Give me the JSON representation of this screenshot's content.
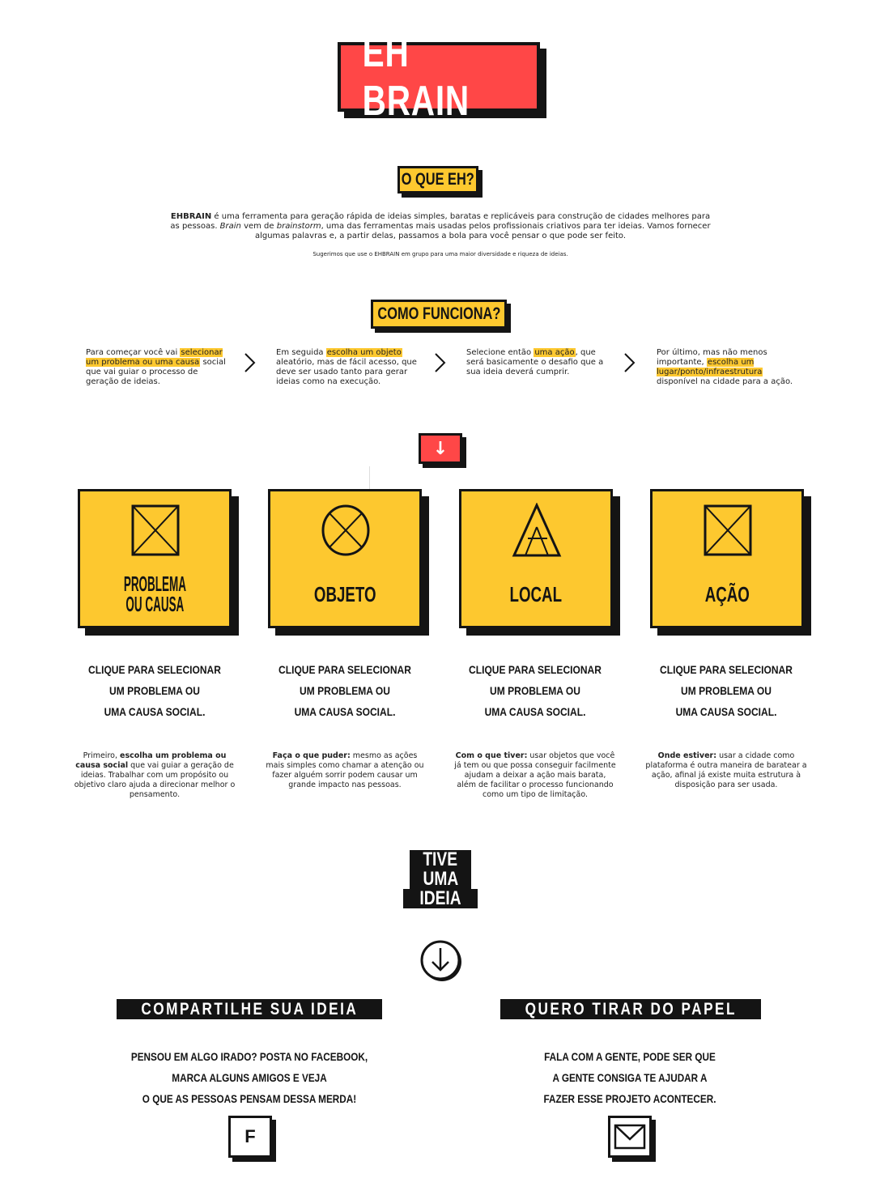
{
  "logo": {
    "text": "EH BRAIN"
  },
  "about": {
    "heading": "O QUE EH?",
    "brand": "EHBRAIN",
    "text_1": " é uma ferramenta para geração rápida de ideias simples, baratas e replicáveis para construção de cidades melhores para as pessoas. ",
    "brain_word": "Brain",
    "text_2": " vem de ",
    "brainstorm_word": "brainstorm",
    "text_3": ", uma das ferramentas mais usadas pelos profissionais criativos para ter ideias. Vamos fornecer algumas palavras e, a partir delas, passamos a bola para você pensar o que pode ser feito.",
    "suggestion": "Sugerimos que use o EHBRAIN em grupo para uma maior diversidade e riqueza de ideias."
  },
  "how": {
    "heading": "COMO FUNCIONA?",
    "steps": [
      {
        "pre": "Para começar você vai ",
        "hl": "selecionar um problema ou uma causa",
        "post": " social que vai guiar o processo de geração de ideias."
      },
      {
        "pre": "Em seguida ",
        "hl": "escolha um objeto",
        "post": " aleatório, mas de fácil acesso, que deve ser usado tanto para gerar ideias como na execução."
      },
      {
        "pre": "Selecione então ",
        "hl": "uma ação",
        "post": ", que será basicamente o desafio que a sua ideia deverá cumprir."
      },
      {
        "pre": "Por último, mas não menos importante, ",
        "hl": "escolha um lugar/ponto/infraestrutura",
        "post": " disponível na cidade para a ação."
      }
    ]
  },
  "start_button": {
    "icon": "arrow-down-icon",
    "glyph": "↓"
  },
  "cards": [
    {
      "label_1": "PROBLEMA",
      "label_2": "OU CAUSA",
      "icon": "crossed-square-icon",
      "cta": [
        "CLIQUE PARA SELECIONAR",
        "UM PROBLEMA OU",
        "UMA CAUSA SOCIAL."
      ],
      "desc_pre": "Primeiro, ",
      "desc_bold": "escolha um problema ou causa social",
      "desc_post": " que vai guiar a geração de ideias. Trabalhar com um propósito ou objetivo claro ajuda a direcionar melhor o pensamento."
    },
    {
      "label_1": "OBJETO",
      "label_2": "",
      "icon": "crossed-circle-icon",
      "cta": [
        "CLIQUE PARA SELECIONAR",
        "UM PROBLEMA OU",
        "UMA CAUSA SOCIAL."
      ],
      "desc_pre": "",
      "desc_bold": "Faça o que puder:",
      "desc_post": " mesmo as ações mais simples como chamar a atenção ou fazer alguém sorrir podem causar um grande impacto nas pessoas."
    },
    {
      "label_1": "LOCAL",
      "label_2": "",
      "icon": "triangle-icon",
      "cta": [
        "CLIQUE PARA SELECIONAR",
        "UM PROBLEMA OU",
        "UMA CAUSA SOCIAL."
      ],
      "desc_pre": "",
      "desc_bold": "Com o que tiver:",
      "desc_post": " usar objetos que você já tem ou que possa conseguir facilmente ajudam a deixar a ação mais barata, além de facilitar o processo funcionando como um tipo de limitação."
    },
    {
      "label_1": "AÇÃO",
      "label_2": "",
      "icon": "crossed-square-icon",
      "cta": [
        "CLIQUE PARA SELECIONAR",
        "UM PROBLEMA OU",
        "UMA CAUSA SOCIAL."
      ],
      "desc_pre": "",
      "desc_bold": "Onde estiver:",
      "desc_post": " usar a cidade como plataforma é outra maneira de baratear a ação, afinal já existe muita estrutura à disposição para ser usada."
    }
  ],
  "idea": {
    "lines": [
      "TIVE",
      "UMA",
      "IDEIA"
    ],
    "icon": "circle-arrow-down-icon"
  },
  "share": {
    "banner": "COMPARTILHE SUA IDEIA",
    "lines": [
      "PENSOU EM ALGO IRADO? POSTA NO FACEBOOK,",
      "MARCA ALGUNS AMIGOS E VEJA",
      "O QUE AS PESSOAS PENSAM DESSA MERDA!"
    ],
    "icon_text": "F",
    "icon": "facebook-icon"
  },
  "contact": {
    "banner": "QUERO TIRAR DO PAPEL",
    "lines": [
      "FALA COM A GENTE, PODE SER QUE",
      "A GENTE CONSIGA TE AJUDAR A",
      "FAZER ESSE PROJETO ACONTECER."
    ],
    "icon": "envelope-icon"
  },
  "colors": {
    "red": "#ff4747",
    "yellow": "#fdc82f",
    "black": "#141414"
  }
}
